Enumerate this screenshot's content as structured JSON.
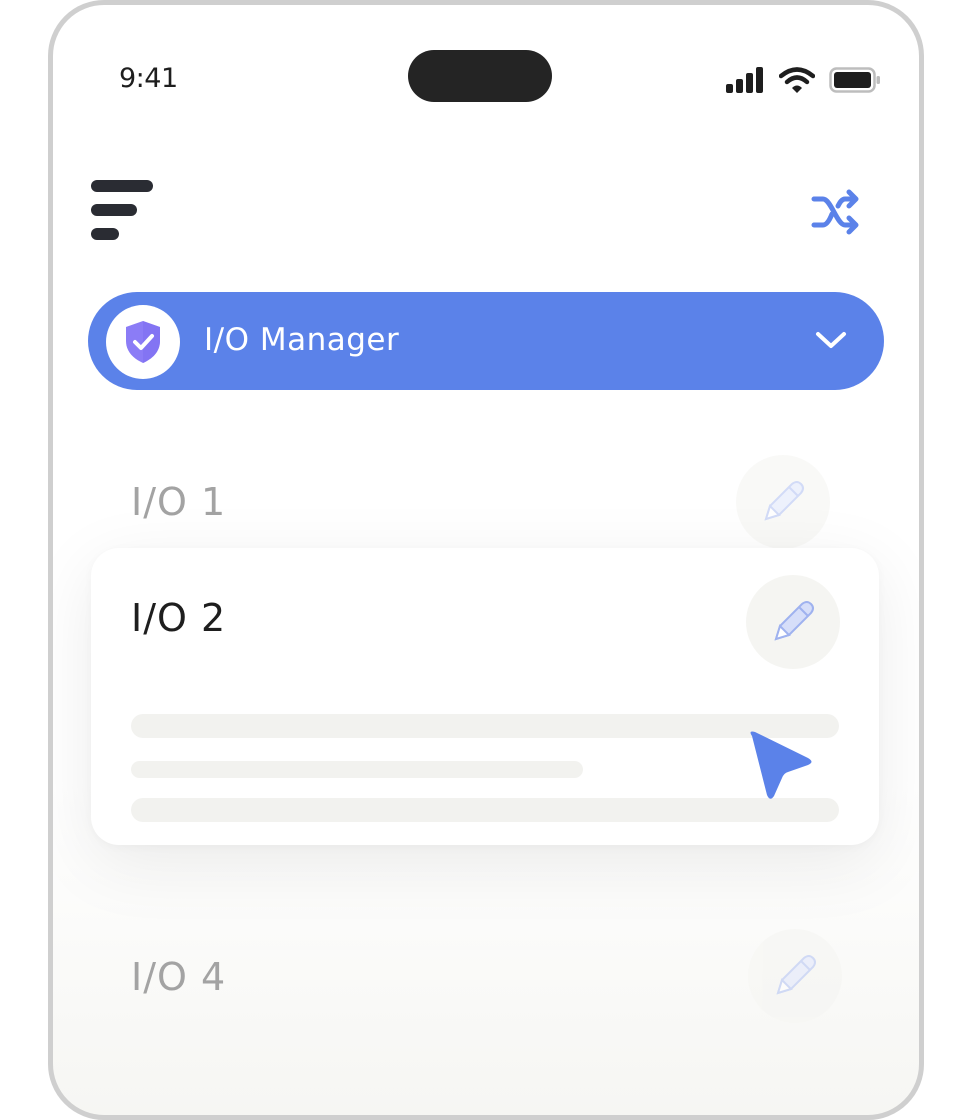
{
  "status_bar": {
    "time": "9:41",
    "icons": [
      "cellular-signal-icon",
      "wifi-icon",
      "battery-icon"
    ]
  },
  "header": {
    "menu_icon": "menu-icon",
    "action_icon": "shuffle-icon"
  },
  "manager": {
    "label": "I/O Manager",
    "avatar_icon": "shield-check-icon",
    "dropdown_icon": "chevron-down-icon"
  },
  "list": {
    "items": [
      {
        "label": "I/O 1",
        "edit_icon": "pencil-icon"
      },
      {
        "label": "I/O 2",
        "edit_icon": "pencil-icon",
        "expanded": true
      },
      {
        "label": "I/O 4",
        "edit_icon": "pencil-icon"
      }
    ]
  },
  "cursor_icon": "pointer-arrow-icon",
  "colors": {
    "accent": "#5b82e9",
    "shield": "#8b7cf6",
    "text_primary": "#1e1e1e",
    "text_muted": "#a3a3a3",
    "skeleton": "#f2f2ef",
    "icon_bg": "#f5f5f2"
  }
}
